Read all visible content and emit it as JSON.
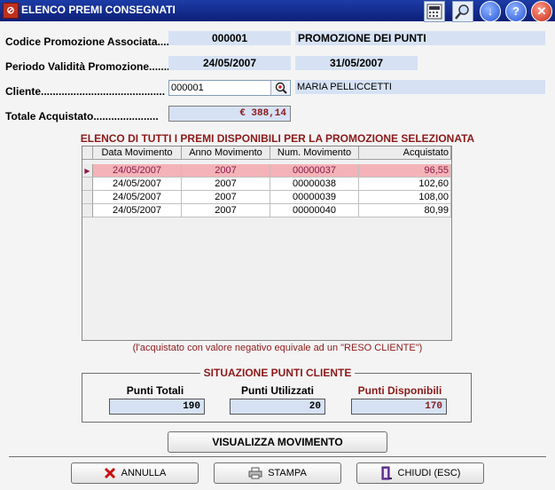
{
  "window": {
    "title": "ELENCO PREMI CONSEGNATI"
  },
  "toolbar": {
    "icons": [
      "calculator-icon",
      "search-icon",
      "download-icon",
      "help-icon",
      "close-icon"
    ],
    "help_glyph": "?",
    "close_glyph": "✕",
    "download_glyph": "↓"
  },
  "form": {
    "codice_label": "Codice Promozione Associata.....",
    "codice_value": "000001",
    "promo_name": "PROMOZIONE DEI PUNTI",
    "periodo_label": "Periodo Validità Promozione.......",
    "date_from": "24/05/2007",
    "date_to": "31/05/2007",
    "cliente_label": "Cliente..........................................",
    "cliente_code": "000001",
    "cliente_name": "MARIA PELLICCETTI",
    "totale_label": "Totale Acquistato......................",
    "totale_value": "€ 388,14"
  },
  "list": {
    "title": "ELENCO DI TUTTI I PREMI DISPONIBILI PER LA PROMOZIONE SELEZIONATA",
    "columns": [
      "Data Movimento",
      "Anno Movimento",
      "Num. Movimento",
      "Acquistato"
    ],
    "rows": [
      [
        "24/05/2007",
        "2007",
        "00000037",
        "96,55"
      ],
      [
        "24/05/2007",
        "2007",
        "00000038",
        "102,60"
      ],
      [
        "24/05/2007",
        "2007",
        "00000039",
        "108,00"
      ],
      [
        "24/05/2007",
        "2007",
        "00000040",
        "80,99"
      ]
    ],
    "selected_index": 0,
    "row_pointer": "▶",
    "note": "(l'acquistato con valore negativo equivale ad un \"RESO CLIENTE\")"
  },
  "punti": {
    "title": "SITUAZIONE PUNTI CLIENTE",
    "totali_label": "Punti Totali",
    "totali_value": "190",
    "utilizzati_label": "Punti Utilizzati",
    "utilizzati_value": "20",
    "disponibili_label": "Punti Disponibili",
    "disponibili_value": "170"
  },
  "buttons": {
    "visualizza": "VISUALIZZA MOVIMENTO",
    "annulla": "ANNULLA",
    "stampa": "STAMPA",
    "chiudi": "CHIUDI (ESC)"
  },
  "colors": {
    "accent": "#8b1a1a",
    "field_bg": "#d6e2f4",
    "selected_row": "#f4b3b8",
    "titlebar": "#1d3ca6"
  }
}
